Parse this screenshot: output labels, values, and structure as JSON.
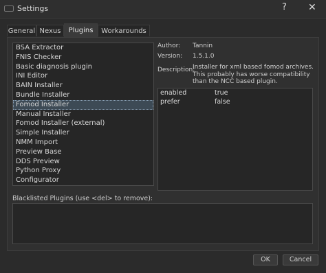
{
  "window": {
    "title": "Settings",
    "help_glyph": "?",
    "close_glyph": "✕"
  },
  "tabs": [
    {
      "label": "General"
    },
    {
      "label": "Nexus"
    },
    {
      "label": "Plugins",
      "active": true
    },
    {
      "label": "Workarounds"
    }
  ],
  "plugins": {
    "items": [
      {
        "label": "BSA Extractor"
      },
      {
        "label": "FNIS Checker"
      },
      {
        "label": "Basic diagnosis plugin"
      },
      {
        "label": "INI Editor"
      },
      {
        "label": "BAIN Installer"
      },
      {
        "label": "Bundle Installer"
      },
      {
        "label": "Fomod Installer",
        "selected": true
      },
      {
        "label": "Manual Installer"
      },
      {
        "label": "Fomod Installer (external)"
      },
      {
        "label": "Simple Installer"
      },
      {
        "label": "NMM Import"
      },
      {
        "label": "Preview Base"
      },
      {
        "label": "DDS Preview"
      },
      {
        "label": "Python Proxy"
      },
      {
        "label": "Configurator"
      }
    ]
  },
  "details": {
    "author_label": "Author:",
    "author": "Tannin",
    "version_label": "Version:",
    "version": "1.5.1.0",
    "description_label": "Description:",
    "description": "Installer for xml based fomod archives. This probably has worse compatibility than the NCC based plugin."
  },
  "settings": {
    "rows": [
      {
        "key": "enabled",
        "value": "true"
      },
      {
        "key": "prefer",
        "value": "false"
      }
    ]
  },
  "blacklist": {
    "label": "Blacklisted Plugins (use <del> to remove):"
  },
  "buttons": {
    "ok": "OK",
    "cancel": "Cancel"
  },
  "colors": {
    "background": "#2b2b2b",
    "selection": "#3d4a55"
  }
}
